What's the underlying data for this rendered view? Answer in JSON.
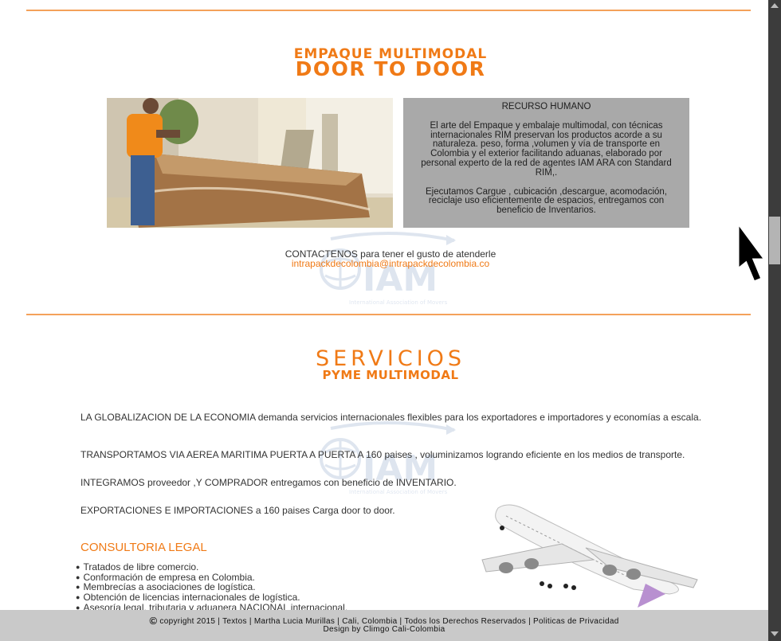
{
  "section1": {
    "subtitle": "EMPAQUE MULTIMODAL",
    "title": "DOOR TO DOOR",
    "graybox": {
      "heading": "RECURSO HUMANO",
      "p1": "El arte del Empaque y embalaje multimodal, con técnicas internacionales RIM   preservan los productos acorde a su naturaleza.  peso, forma ,volumen  y vía de transporte  en Colombia y el  exterior facilitando aduanas, elaborado por  personal  experto de la red de agentes  IAM  ARA  con Standard RIM,.",
      "p2": "Ejecutamos  Cargue  , cubicación ,descargue, acomodación, reciclaje  uso eficientemente de espacios, entregamos  con beneficio de  Inventarios."
    },
    "contact_text": "CONTACTENOS para tener el gusto de atenderle",
    "contact_email": "intrapackdecolombia@intrapackdecolombia.co"
  },
  "watermark": {
    "logo": "IAM",
    "tagline": "International Association of Movers"
  },
  "section2": {
    "title": "SERVICIOS",
    "subtitle": "PYME MULTIMODAL",
    "p1": "LA GLOBALIZACION  DE LA ECONOMIA demanda servicios internacionales flexibles  para los   exportadores e importadores  y economías a escala.",
    "p2": "TRANSPORTAMOS  VIA AEREA MARITIMA PUERTA A PUERTA A 160 paises  , voluminizamos logrando   eficiente  en los medios de transporte.",
    "p3": "INTEGRAMOS  proveedor ,Y COMPRADOR  entregamos  con beneficio de INVENTARIO.",
    "p4": "EXPORTACIONES E IMPORTACIONES a  160 paises Carga door to door.",
    "consultoria_heading": "CONSULTORIA  LEGAL",
    "bullets": [
      "Tratados  de libre comercio.",
      "Conformación de empresa en Colombia.",
      "Membrecías a  asociaciones de logística.",
      "Obtención de  licencias internacionales  de logística.",
      "Asesoría  legal, tributaria y aduanera NACIONAL   internacional."
    ]
  },
  "footer": {
    "copyright_symbol": "©",
    "line1": "copyright 2015 | Textos | Martha Lucia Murillas | Cali, Colombia | Todos los Derechos Reservados | Politicas de Privacidad",
    "line2": "Design by Climgo Cali-Colombia"
  },
  "colors": {
    "accent": "#f07a16",
    "rule": "#f4a15a",
    "graybox": "#a9a9a9",
    "footer": "#c9c9c9"
  }
}
